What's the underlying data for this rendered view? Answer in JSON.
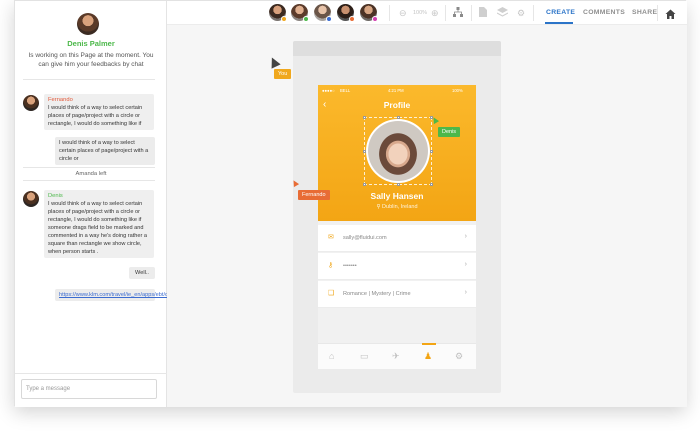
{
  "sidebar": {
    "owner_name": "Denis Palmer",
    "owner_status": "Is working on this Page at the moment. You can give him your feedbacks by chat",
    "messages": [
      {
        "author": "Fernando",
        "text": "I would think of a way to select certain places of page/project with a circle or rectangle, I would do something like if"
      },
      {
        "text": "I would think of a way to select certain places of page/project with a circle or"
      },
      {
        "author": "Denis",
        "text": "I would think of a way to select certain places of page/project with a circle or rectangle, I would do something like if someone drags field to be marked and commented in a way he's doing rather a square than rectangle we show circle, when person starts ."
      },
      {
        "text": "Well.."
      },
      {
        "link": "https://www.klm.com/travel/ie_en/apps/ebt/calendar.htm?"
      }
    ],
    "system_note": "Amanda left",
    "input_placeholder": "Type a message"
  },
  "topbar": {
    "zoom": "100%",
    "tabs": [
      "CREATE",
      "COMMENTS",
      "SHARE"
    ],
    "active_tab": "CREATE",
    "collaborators": [
      {
        "name": "collaborator-1",
        "status_color": "#f0a81e"
      },
      {
        "name": "collaborator-2",
        "status_color": "#4cb84a"
      },
      {
        "name": "collaborator-3",
        "status_color": "#3a6bd0"
      },
      {
        "name": "collaborator-4",
        "status_color": "#e86c35"
      },
      {
        "name": "collaborator-5",
        "status_color": "#d33fb0"
      }
    ]
  },
  "phone": {
    "status_carrier": "BELL",
    "status_time": "4:21 PM",
    "status_battery": "100%",
    "title": "Profile",
    "name": "Sally Hansen",
    "location": "Dublin, Ireland",
    "rows": [
      {
        "icon": "mail-icon",
        "text": "sally@fluidui.com"
      },
      {
        "icon": "key-icon",
        "text": "•••••••"
      },
      {
        "icon": "book-icon",
        "text": "Romance | Mystery | Crime"
      }
    ],
    "tabbar_icons": [
      "home-icon",
      "ticket-icon",
      "flight-icon",
      "profile-icon",
      "settings-icon"
    ],
    "active_tab_index": 3
  },
  "cursors": {
    "you": "You",
    "denis": "Denis",
    "fernando": "Fernando"
  },
  "colors": {
    "accent": "#2b74c8",
    "header": "#f3a514",
    "green": "#4cb84a",
    "orange": "#e86c35"
  }
}
